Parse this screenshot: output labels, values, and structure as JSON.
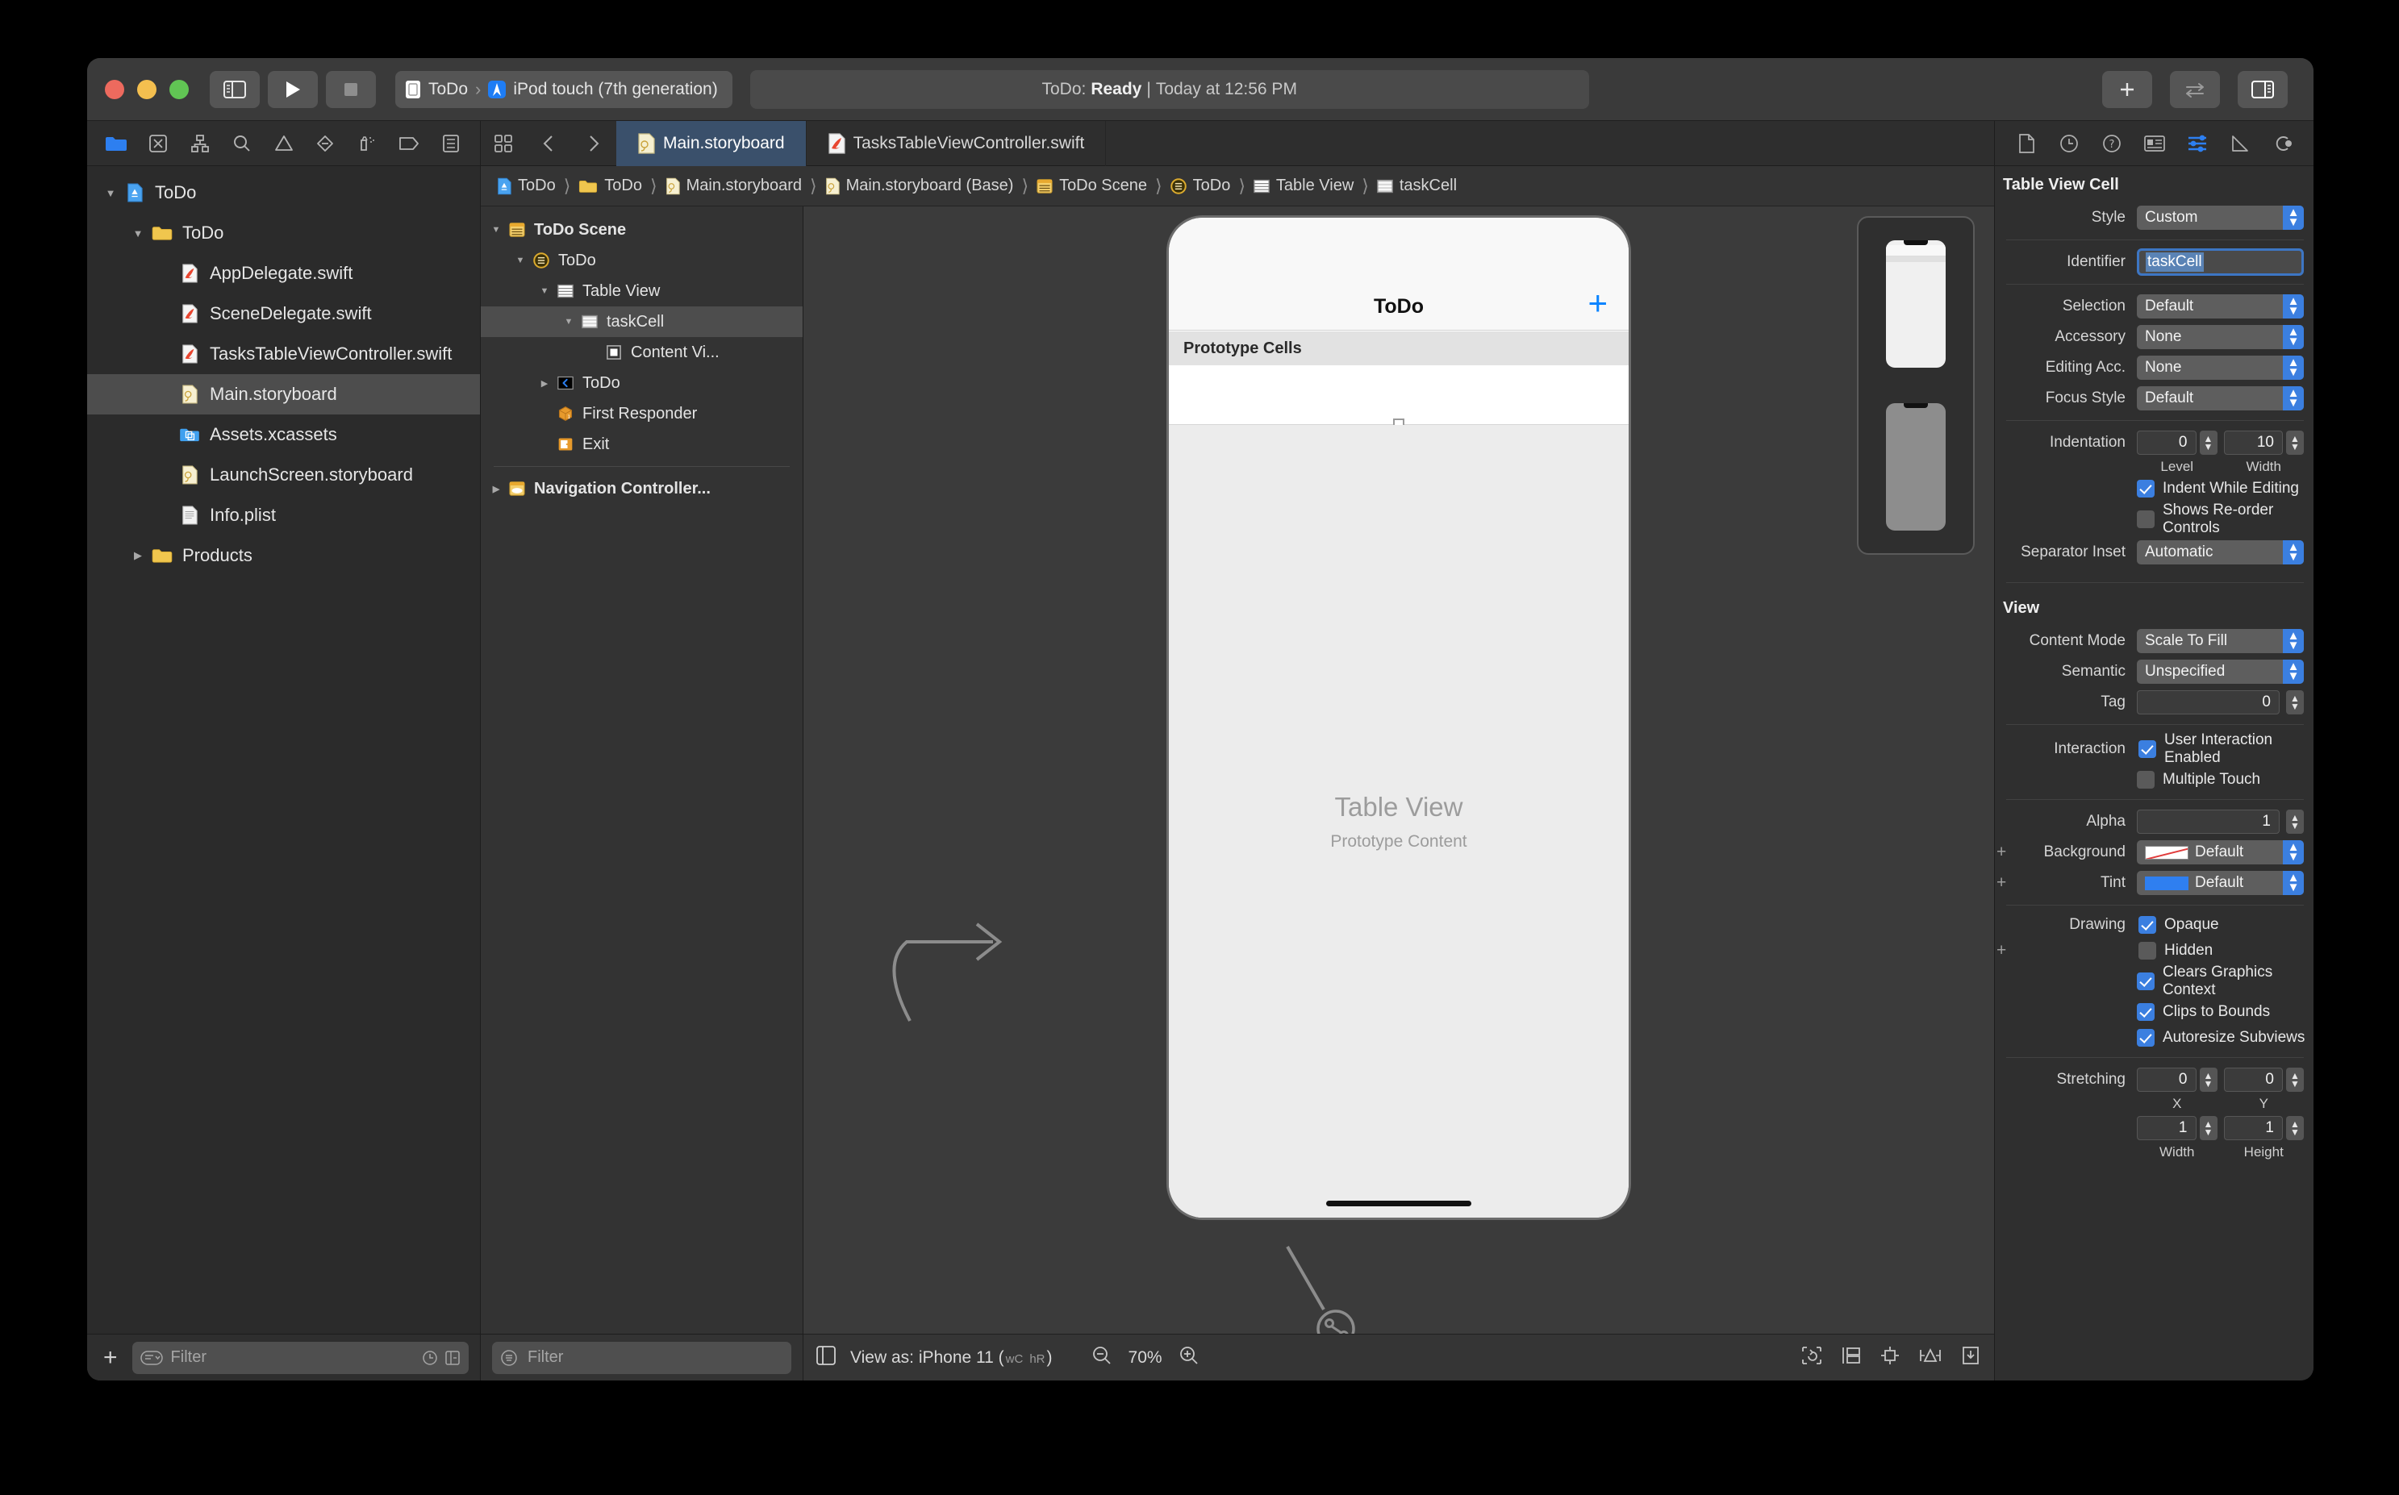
{
  "toolbar": {
    "sidebar_toggle": "sidebar-toggle",
    "run_label": "Run",
    "stop_label": "Stop",
    "scheme_target": "ToDo",
    "scheme_device": "iPod touch (7th generation)",
    "status_project": "ToDo:",
    "status_state": "Ready",
    "status_sep": "|",
    "status_time": "Today at 12:56 PM",
    "add_label": "+",
    "assistant_label": "assistant-editor",
    "inspector_toggle": "inspector-toggle"
  },
  "navigator": {
    "tabs": [
      {
        "name": "project-navigator",
        "active": true
      },
      {
        "name": "source-control-navigator",
        "active": false
      },
      {
        "name": "symbol-navigator",
        "active": false
      },
      {
        "name": "find-navigator",
        "active": false
      },
      {
        "name": "issue-navigator",
        "active": false
      },
      {
        "name": "test-navigator",
        "active": false
      },
      {
        "name": "debug-navigator",
        "active": false
      },
      {
        "name": "breakpoint-navigator",
        "active": false
      },
      {
        "name": "report-navigator",
        "active": false
      }
    ],
    "items": [
      {
        "label": "ToDo",
        "icon": "xcode-project",
        "depth": 0,
        "twisty": "down",
        "selected": false
      },
      {
        "label": "ToDo",
        "icon": "folder",
        "depth": 1,
        "twisty": "down",
        "selected": false
      },
      {
        "label": "AppDelegate.swift",
        "icon": "swift",
        "depth": 2,
        "twisty": "",
        "selected": false
      },
      {
        "label": "SceneDelegate.swift",
        "icon": "swift",
        "depth": 2,
        "twisty": "",
        "selected": false
      },
      {
        "label": "TasksTableViewController.swift",
        "icon": "swift",
        "depth": 2,
        "twisty": "",
        "selected": false
      },
      {
        "label": "Main.storyboard",
        "icon": "storyboard",
        "depth": 2,
        "twisty": "",
        "selected": true
      },
      {
        "label": "Assets.xcassets",
        "icon": "assets",
        "depth": 2,
        "twisty": "",
        "selected": false
      },
      {
        "label": "LaunchScreen.storyboard",
        "icon": "storyboard",
        "depth": 2,
        "twisty": "",
        "selected": false
      },
      {
        "label": "Info.plist",
        "icon": "plist",
        "depth": 2,
        "twisty": "",
        "selected": false
      },
      {
        "label": "Products",
        "icon": "folder",
        "depth": 1,
        "twisty": "right",
        "selected": false
      }
    ],
    "filter_placeholder": "Filter",
    "add_button": "+"
  },
  "editor": {
    "tabs": [
      {
        "label": "Main.storyboard",
        "icon": "storyboard",
        "active": true
      },
      {
        "label": "TasksTableViewController.swift",
        "icon": "swift",
        "active": false
      }
    ],
    "breadcrumb": [
      {
        "label": "ToDo",
        "icon": "xcode-project"
      },
      {
        "label": "ToDo",
        "icon": "folder"
      },
      {
        "label": "Main.storyboard",
        "icon": "storyboard"
      },
      {
        "label": "Main.storyboard (Base)",
        "icon": "storyboard"
      },
      {
        "label": "ToDo Scene",
        "icon": "scene"
      },
      {
        "label": "ToDo",
        "icon": "view-controller"
      },
      {
        "label": "Table View",
        "icon": "table-view"
      },
      {
        "label": "taskCell",
        "icon": "table-cell"
      }
    ]
  },
  "outline": {
    "items": [
      {
        "label": "ToDo Scene",
        "icon": "scene",
        "depth": 0,
        "twisty": "down",
        "selected": false,
        "bold": true
      },
      {
        "label": "ToDo",
        "icon": "view-controller",
        "depth": 1,
        "twisty": "down",
        "selected": false,
        "bold": false
      },
      {
        "label": "Table View",
        "icon": "table-view",
        "depth": 2,
        "twisty": "down",
        "selected": false,
        "bold": false
      },
      {
        "label": "taskCell",
        "icon": "table-cell",
        "depth": 3,
        "twisty": "down",
        "selected": true,
        "bold": false
      },
      {
        "label": "Content Vi...",
        "icon": "content-view",
        "depth": 4,
        "twisty": "",
        "selected": false,
        "bold": false
      },
      {
        "label": "ToDo",
        "icon": "nav-item",
        "depth": 2,
        "twisty": "right",
        "selected": false,
        "bold": false
      },
      {
        "label": "First Responder",
        "icon": "first-responder",
        "depth": 2,
        "twisty": "",
        "selected": false,
        "bold": false
      },
      {
        "label": "Exit",
        "icon": "exit",
        "depth": 2,
        "twisty": "",
        "selected": false,
        "bold": false
      }
    ],
    "footer_item": {
      "label": "Navigation Controller...",
      "icon": "nav-scene",
      "twisty": "right"
    },
    "filter_placeholder": "Filter"
  },
  "canvas": {
    "device_title": "ToDo",
    "add_item_icon": "+",
    "prototype_cells_label": "Prototype Cells",
    "table_view_title": "Table View",
    "table_view_subtitle": "Prototype Content",
    "bottom": {
      "outline_toggle": "document-outline-toggle",
      "view_as_prefix": "View as: iPhone 11 (",
      "view_as_wc": "wC",
      "view_as_hr": "hR",
      "view_as_suffix": ")",
      "zoom_out": "zoom-out",
      "zoom_level": "70%",
      "zoom_in": "zoom-in",
      "update_frames": "update-frames",
      "embed_in": "embed-in",
      "align": "align",
      "add_constraints": "add-new-constraints",
      "resolve_issues": "resolve-auto-layout-issues"
    }
  },
  "inspector": {
    "tabs": [
      {
        "name": "file-inspector",
        "active": false
      },
      {
        "name": "history-inspector",
        "active": false
      },
      {
        "name": "quick-help-inspector",
        "active": false
      },
      {
        "name": "identity-inspector",
        "active": false
      },
      {
        "name": "attributes-inspector",
        "active": true
      },
      {
        "name": "size-inspector",
        "active": false
      },
      {
        "name": "connections-inspector",
        "active": false
      }
    ],
    "cell_section": {
      "title": "Table View Cell",
      "style_label": "Style",
      "style_value": "Custom",
      "identifier_label": "Identifier",
      "identifier_value": "taskCell",
      "selection_label": "Selection",
      "selection_value": "Default",
      "accessory_label": "Accessory",
      "accessory_value": "None",
      "editing_acc_label": "Editing Acc.",
      "editing_acc_value": "None",
      "focus_style_label": "Focus Style",
      "focus_style_value": "Default",
      "indentation_label": "Indentation",
      "indentation_level": "0",
      "indentation_width": "10",
      "level_sublabel": "Level",
      "width_sublabel": "Width",
      "indent_while_editing_label": "Indent While Editing",
      "indent_while_editing_checked": true,
      "reorder_label": "Shows Re-order Controls",
      "reorder_checked": false,
      "separator_inset_label": "Separator Inset",
      "separator_inset_value": "Automatic"
    },
    "view_section": {
      "title": "View",
      "content_mode_label": "Content Mode",
      "content_mode_value": "Scale To Fill",
      "semantic_label": "Semantic",
      "semantic_value": "Unspecified",
      "tag_label": "Tag",
      "tag_value": "0",
      "interaction_label": "Interaction",
      "user_interaction_label": "User Interaction Enabled",
      "user_interaction_checked": true,
      "multiple_touch_label": "Multiple Touch",
      "multiple_touch_checked": false,
      "alpha_label": "Alpha",
      "alpha_value": "1",
      "background_label": "Background",
      "background_value": "Default",
      "tint_label": "Tint",
      "tint_value": "Default",
      "drawing_label": "Drawing",
      "opaque_label": "Opaque",
      "opaque_checked": true,
      "hidden_label": "Hidden",
      "hidden_checked": false,
      "clears_graphics_label": "Clears Graphics Context",
      "clears_graphics_checked": true,
      "clips_label": "Clips to Bounds",
      "clips_checked": true,
      "autoresize_label": "Autoresize Subviews",
      "autoresize_checked": true,
      "stretching_label": "Stretching",
      "stretch_x": "0",
      "stretch_y": "0",
      "stretch_w": "1",
      "stretch_h": "1",
      "x_sublabel": "X",
      "y_sublabel": "Y",
      "width_sublabel": "Width",
      "height_sublabel": "Height"
    }
  },
  "colors": {
    "accent_blue": "#3b7fe0",
    "tint_blue": "#2f7ff0",
    "selection_grey": "#4d4d4d",
    "tab_active": "#3a506b"
  }
}
